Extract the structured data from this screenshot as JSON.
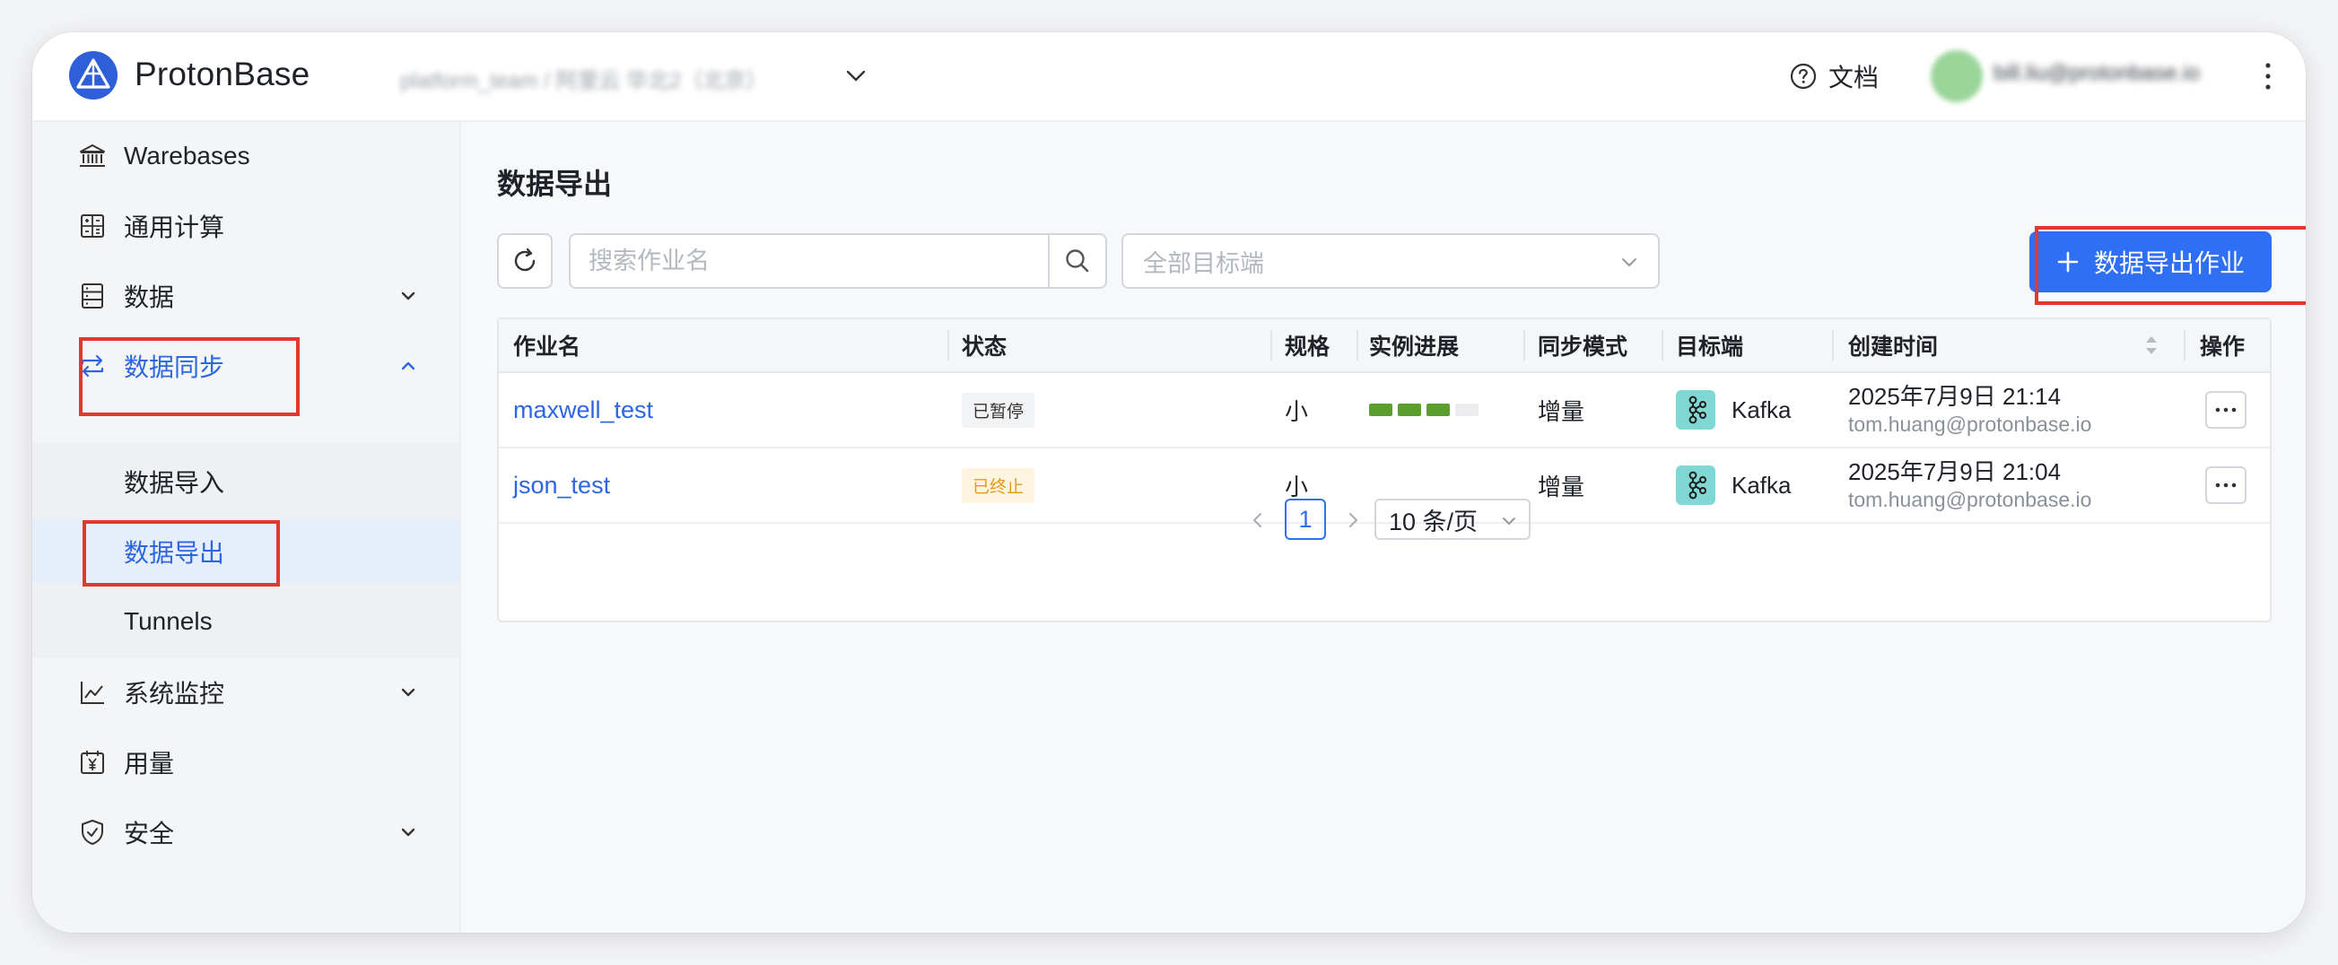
{
  "header": {
    "brand": "ProtonBase",
    "workspace": "platform_team / 阿里云 华北2（北京）",
    "docs_label": "文档",
    "user_email": "bill.liu@protonbase.io"
  },
  "sidebar": {
    "items": [
      {
        "label": "Warebases",
        "icon": "bank-icon"
      },
      {
        "label": "通用计算",
        "icon": "calculator-icon"
      },
      {
        "label": "数据",
        "icon": "database-icon"
      },
      {
        "label": "数据同步",
        "icon": "sync-icon"
      },
      {
        "label": "系统监控",
        "icon": "chart-line-icon"
      },
      {
        "label": "用量",
        "icon": "yen-calendar-icon"
      },
      {
        "label": "安全",
        "icon": "shield-icon"
      }
    ],
    "sync_children": [
      "数据导入",
      "数据导出",
      "Tunnels"
    ]
  },
  "main": {
    "title": "数据导出",
    "search_placeholder": "搜索作业名",
    "target_placeholder": "全部目标端",
    "create_button": "数据导出作业",
    "columns": [
      "作业名",
      "状态",
      "规格",
      "实例进展",
      "同步模式",
      "目标端",
      "创建时间",
      "操作"
    ],
    "rows": [
      {
        "name": "maxwell_test",
        "status": "已暂停",
        "status_type": "paused",
        "spec": "小",
        "progress": 0.75,
        "mode": "增量",
        "target": "Kafka",
        "created": "2025年7月9日 21:14",
        "creator": "tom.huang@protonbase.io"
      },
      {
        "name": "json_test",
        "status": "已终止",
        "status_type": "stopped",
        "spec": "小",
        "progress": null,
        "mode": "增量",
        "target": "Kafka",
        "created": "2025年7月9日 21:04",
        "creator": "tom.huang@protonbase.io"
      }
    ],
    "pagination": {
      "current": "1",
      "page_size": "10 条/页"
    }
  },
  "colors": {
    "accent": "#2f6ff3",
    "link": "#2c66e0",
    "highlight": "#e03a2f",
    "progress": "#5c9e2d"
  }
}
